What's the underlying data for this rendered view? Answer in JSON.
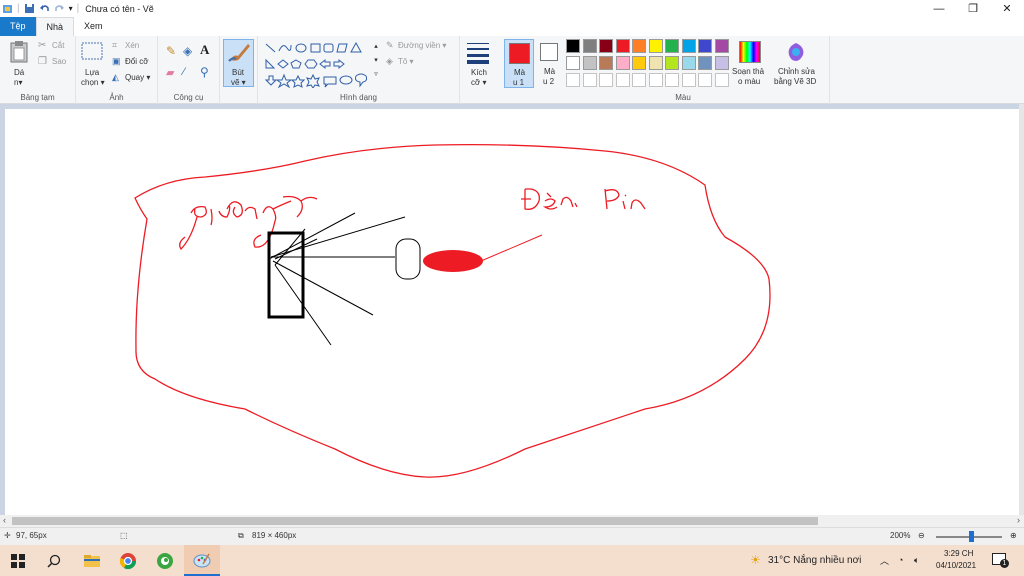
{
  "window": {
    "title": "Chưa có tên - Vẽ"
  },
  "tabs": [
    "Tệp",
    "Nhà",
    "Xem"
  ],
  "ribbon": {
    "clipboard": {
      "paste_line1": "Dá",
      "paste_line2": "n▾",
      "cut": "Cắt",
      "copy": "Sao",
      "label": "Bảng tạm"
    },
    "image": {
      "select_line1": "Lựa",
      "select_line2": "chọn ▾",
      "crop": "Xén",
      "resize": "Đổi cỡ",
      "rotate": "Quay ▾",
      "label": "Ảnh"
    },
    "tools": {
      "label": "Công cụ"
    },
    "brushes": {
      "line1": "Bút",
      "line2": "vẽ ▾"
    },
    "shapes": {
      "outline": "Đường viền ▾",
      "fill": "Tô ▾",
      "label": "Hình dạng"
    },
    "size": {
      "line1": "Kích",
      "line2": "cỡ ▾"
    },
    "color1": {
      "line1": "Mà",
      "line2": "u 1",
      "value": "#ed1c24"
    },
    "color2": {
      "line1": "Mà",
      "line2": "u 2",
      "value": "#ffffff"
    },
    "colors": {
      "label": "Màu",
      "row1": [
        "#000000",
        "#7f7f7f",
        "#880015",
        "#ed1c24",
        "#ff7f27",
        "#fff200",
        "#22b14c",
        "#00a2e8",
        "#3f48cc",
        "#a349a4"
      ],
      "row2": [
        "#ffffff",
        "#c3c3c3",
        "#b97a57",
        "#ffaec9",
        "#ffc90e",
        "#efe4b0",
        "#b5e61d",
        "#99d9ea",
        "#7092be",
        "#c8bfe7"
      ]
    },
    "edit_colors": {
      "line1": "Soạn thả",
      "line2": "o màu"
    },
    "paint3d": {
      "line1": "Chỉnh sửa",
      "line2": "bằng Vẽ 3D"
    }
  },
  "status": {
    "position": "97, 65px",
    "size": "819 × 460px",
    "zoom": "200%"
  },
  "taskbar": {
    "weather": "31°C  Nắng nhiều nơi",
    "time": "3:29 CH",
    "date": "04/10/2021",
    "notifications": "1"
  }
}
